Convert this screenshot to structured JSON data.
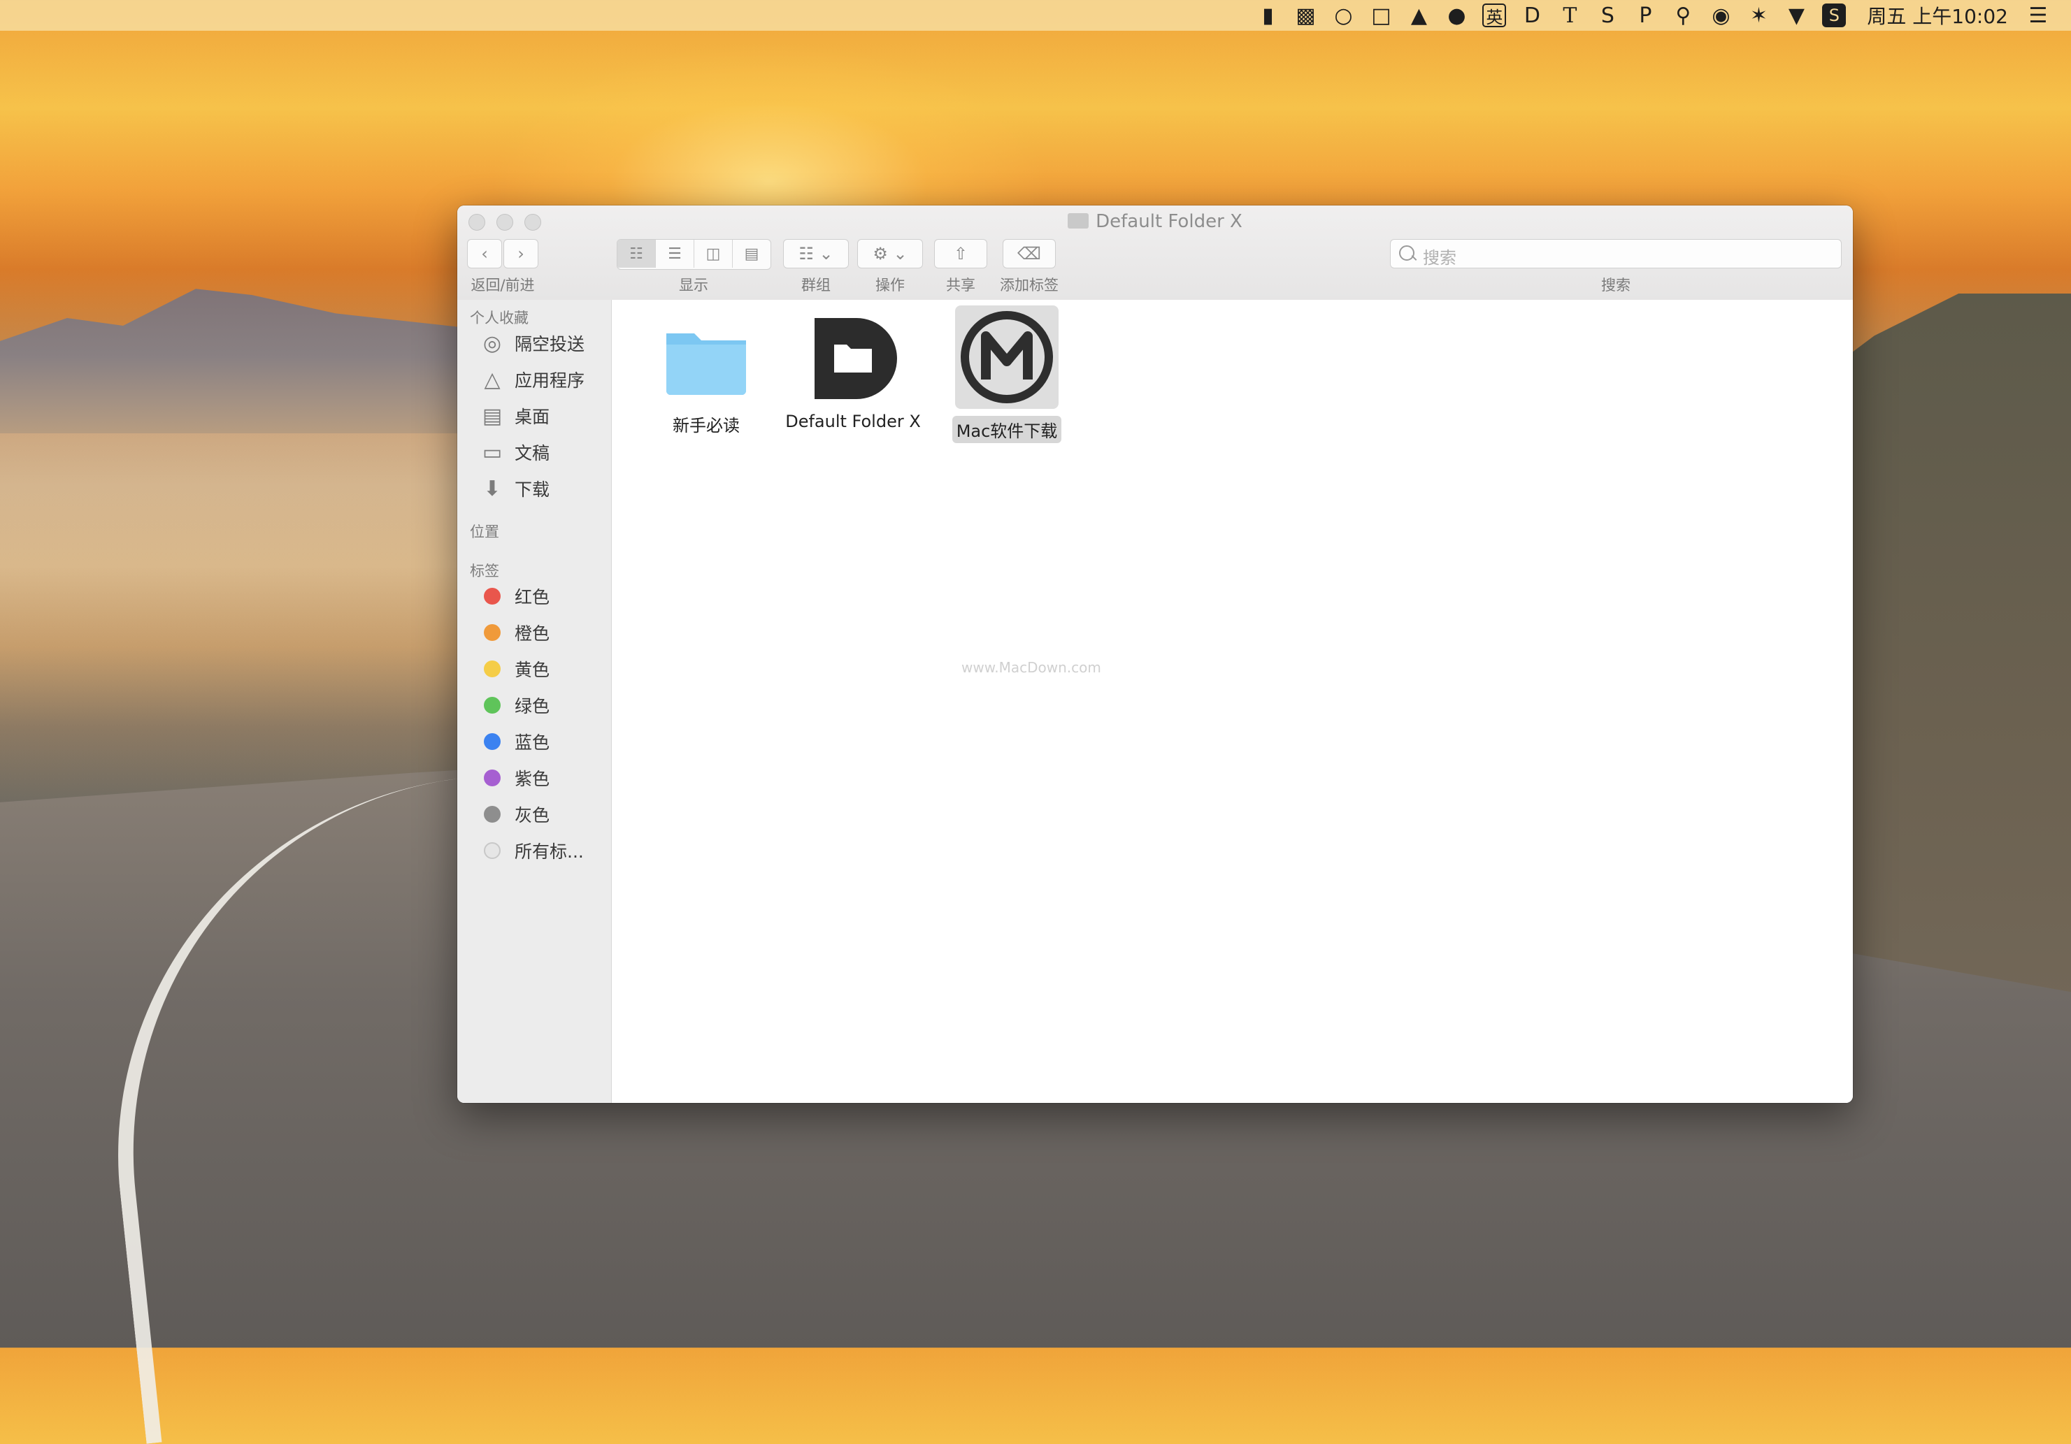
{
  "menubar": {
    "icons": [
      "bookmark-icon",
      "facetime-icon",
      "wechat-icon",
      "screen-icon",
      "cloud-icon",
      "mic-icon",
      "input-ying-icon",
      "d-icon",
      "t-icon",
      "s-icon",
      "p-icon",
      "spotlight-icon",
      "siri-icon",
      "bluetooth-icon",
      "wifi-icon",
      "app-s-icon",
      "list-icon"
    ],
    "input_label": "英",
    "clock": "周五 上午10:02"
  },
  "window": {
    "title": "Default Folder X",
    "toolbar": {
      "back_forward_label": "返回/前进",
      "view_label": "显示",
      "group_label": "群组",
      "action_label": "操作",
      "share_label": "共享",
      "tag_label": "添加标签",
      "search_label": "搜索",
      "search_placeholder": "搜索"
    },
    "sidebar": {
      "favorites_header": "个人收藏",
      "favorites": [
        {
          "label": "隔空投送",
          "icon": "airdrop-icon"
        },
        {
          "label": "应用程序",
          "icon": "applications-icon"
        },
        {
          "label": "桌面",
          "icon": "desktop-icon"
        },
        {
          "label": "文稿",
          "icon": "documents-icon"
        },
        {
          "label": "下载",
          "icon": "downloads-icon"
        }
      ],
      "locations_header": "位置",
      "tags_header": "标签",
      "tags": [
        {
          "label": "红色",
          "color": "#e9564c"
        },
        {
          "label": "橙色",
          "color": "#f09a3a"
        },
        {
          "label": "黄色",
          "color": "#f5cd47"
        },
        {
          "label": "绿色",
          "color": "#5fc45a"
        },
        {
          "label": "蓝色",
          "color": "#3b82f0"
        },
        {
          "label": "紫色",
          "color": "#a65fd1"
        },
        {
          "label": "灰色",
          "color": "#8e8e8e"
        },
        {
          "label": "所有标...",
          "color": "#e6e6e6"
        }
      ]
    },
    "files": [
      {
        "label": "新手必读",
        "icon": "folder-icon"
      },
      {
        "label": "Default Folder X",
        "icon": "default-folder-x-app-icon"
      },
      {
        "label": "Mac软件下载",
        "icon": "macdown-app-icon"
      }
    ],
    "watermark": "www.MacDown.com"
  }
}
